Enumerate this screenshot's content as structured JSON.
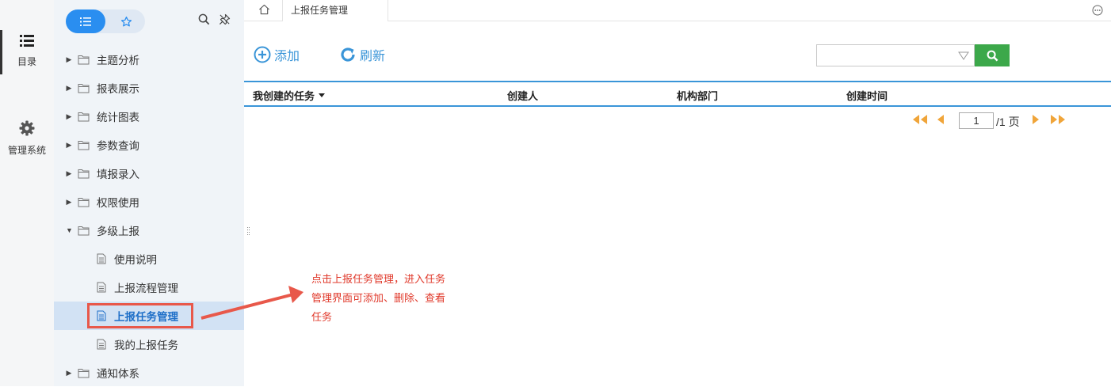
{
  "rail": {
    "catalog_label": "目录",
    "admin_label": "管理系统"
  },
  "tree": {
    "nodes": [
      {
        "label": "主题分析",
        "expanded": false
      },
      {
        "label": "报表展示",
        "expanded": false
      },
      {
        "label": "统计图表",
        "expanded": false
      },
      {
        "label": "参数查询",
        "expanded": false
      },
      {
        "label": "填报录入",
        "expanded": false
      },
      {
        "label": "权限使用",
        "expanded": false
      },
      {
        "label": "多级上报",
        "expanded": true
      },
      {
        "label": "使用说明"
      },
      {
        "label": "上报流程管理"
      },
      {
        "label": "上报任务管理",
        "selected": true
      },
      {
        "label": "我的上报任务"
      },
      {
        "label": "通知体系",
        "expanded": false
      }
    ]
  },
  "main": {
    "tab_title": "上报任务管理",
    "add_label": "添加",
    "refresh_label": "刷新",
    "search_value": "",
    "table": {
      "columns": [
        "我创建的任务",
        "创建人",
        "机构部门",
        "创建时间"
      ],
      "rows": []
    },
    "pager": {
      "current_page": "1",
      "total_text": "/1 页"
    }
  },
  "annotation": {
    "lines": [
      "点击上报任务管理，进入任务",
      "管理界面可添加、删除、查看",
      "任务"
    ]
  },
  "colors": {
    "accent": "#2a8ef0",
    "link": "#3a95d8",
    "search_button": "#3ca84a",
    "pager_arrows": "#f0a53a",
    "annotation": "#e0392b"
  }
}
